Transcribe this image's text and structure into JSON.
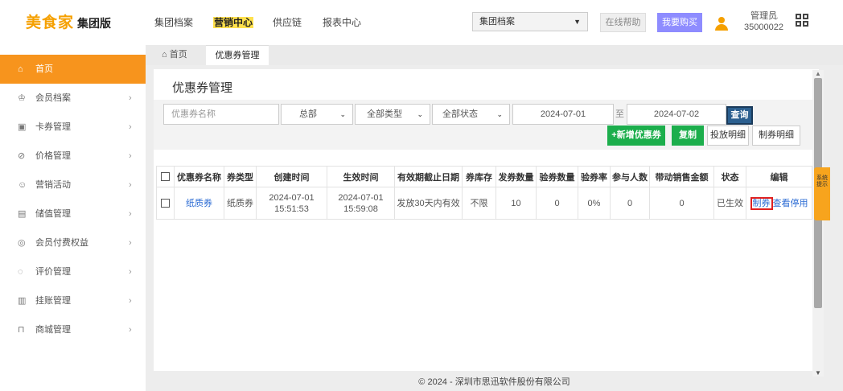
{
  "header": {
    "logo": "美食家",
    "logo_sub": "集团版",
    "nav": [
      "集团档案",
      "营销中心",
      "供应链",
      "报表中心"
    ],
    "store_select": "集团档案",
    "help_label": "在线帮助",
    "buy_label": "我要购买",
    "user_role": "管理员",
    "user_id": "35000022"
  },
  "sidebar": {
    "items": [
      {
        "label": "首页",
        "icon": "home-icon",
        "glyph": "⌂"
      },
      {
        "label": "会员档案",
        "icon": "member-icon",
        "glyph": "♔"
      },
      {
        "label": "卡券管理",
        "icon": "card-icon",
        "glyph": "▣"
      },
      {
        "label": "价格管理",
        "icon": "price-icon",
        "glyph": "⊘"
      },
      {
        "label": "营销活动",
        "icon": "marketing-icon",
        "glyph": "☺"
      },
      {
        "label": "储值管理",
        "icon": "stored-value-icon",
        "glyph": "▤"
      },
      {
        "label": "会员付费权益",
        "icon": "paid-rights-icon",
        "glyph": "◎"
      },
      {
        "label": "评价管理",
        "icon": "review-icon",
        "glyph": "◌"
      },
      {
        "label": "挂账管理",
        "icon": "credit-icon",
        "glyph": "▥"
      },
      {
        "label": "商城管理",
        "icon": "mall-icon",
        "glyph": "⊓"
      }
    ]
  },
  "tabs": {
    "home": "首页",
    "current": "优惠券管理"
  },
  "page": {
    "title": "优惠券管理",
    "filters": {
      "name_placeholder": "优惠券名称",
      "org": "总部",
      "type": "全部类型",
      "status": "全部状态",
      "date_from": "2024-07-01",
      "date_sep": "至",
      "date_to": "2024-07-02"
    },
    "buttons": {
      "query": "查询",
      "add": "+新增优惠券",
      "copy": "复制",
      "issue_detail": "投放明细",
      "make_detail": "制券明细"
    },
    "table": {
      "headers": [
        "优惠券名称",
        "券类型",
        "创建时间",
        "生效时间",
        "有效期截止日期",
        "券库存",
        "发券数量",
        "验券数量",
        "验券率",
        "参与人数",
        "带动销售金额",
        "状态",
        "编辑"
      ],
      "rows": [
        {
          "name": "纸质券",
          "type": "纸质券",
          "created": "2024-07-01 15:51:53",
          "effective": "2024-07-01 15:59:08",
          "expiry": "发放30天内有效",
          "stock": "不限",
          "issued": "10",
          "verified": "0",
          "rate": "0%",
          "participants": "0",
          "sales": "0",
          "status": "已生效",
          "actions": {
            "make": "制券",
            "view": "查看",
            "stop": "停用"
          }
        }
      ]
    }
  },
  "side_tip": "系统提示",
  "footer": "© 2024 - 深圳市思迅软件股份有限公司"
}
